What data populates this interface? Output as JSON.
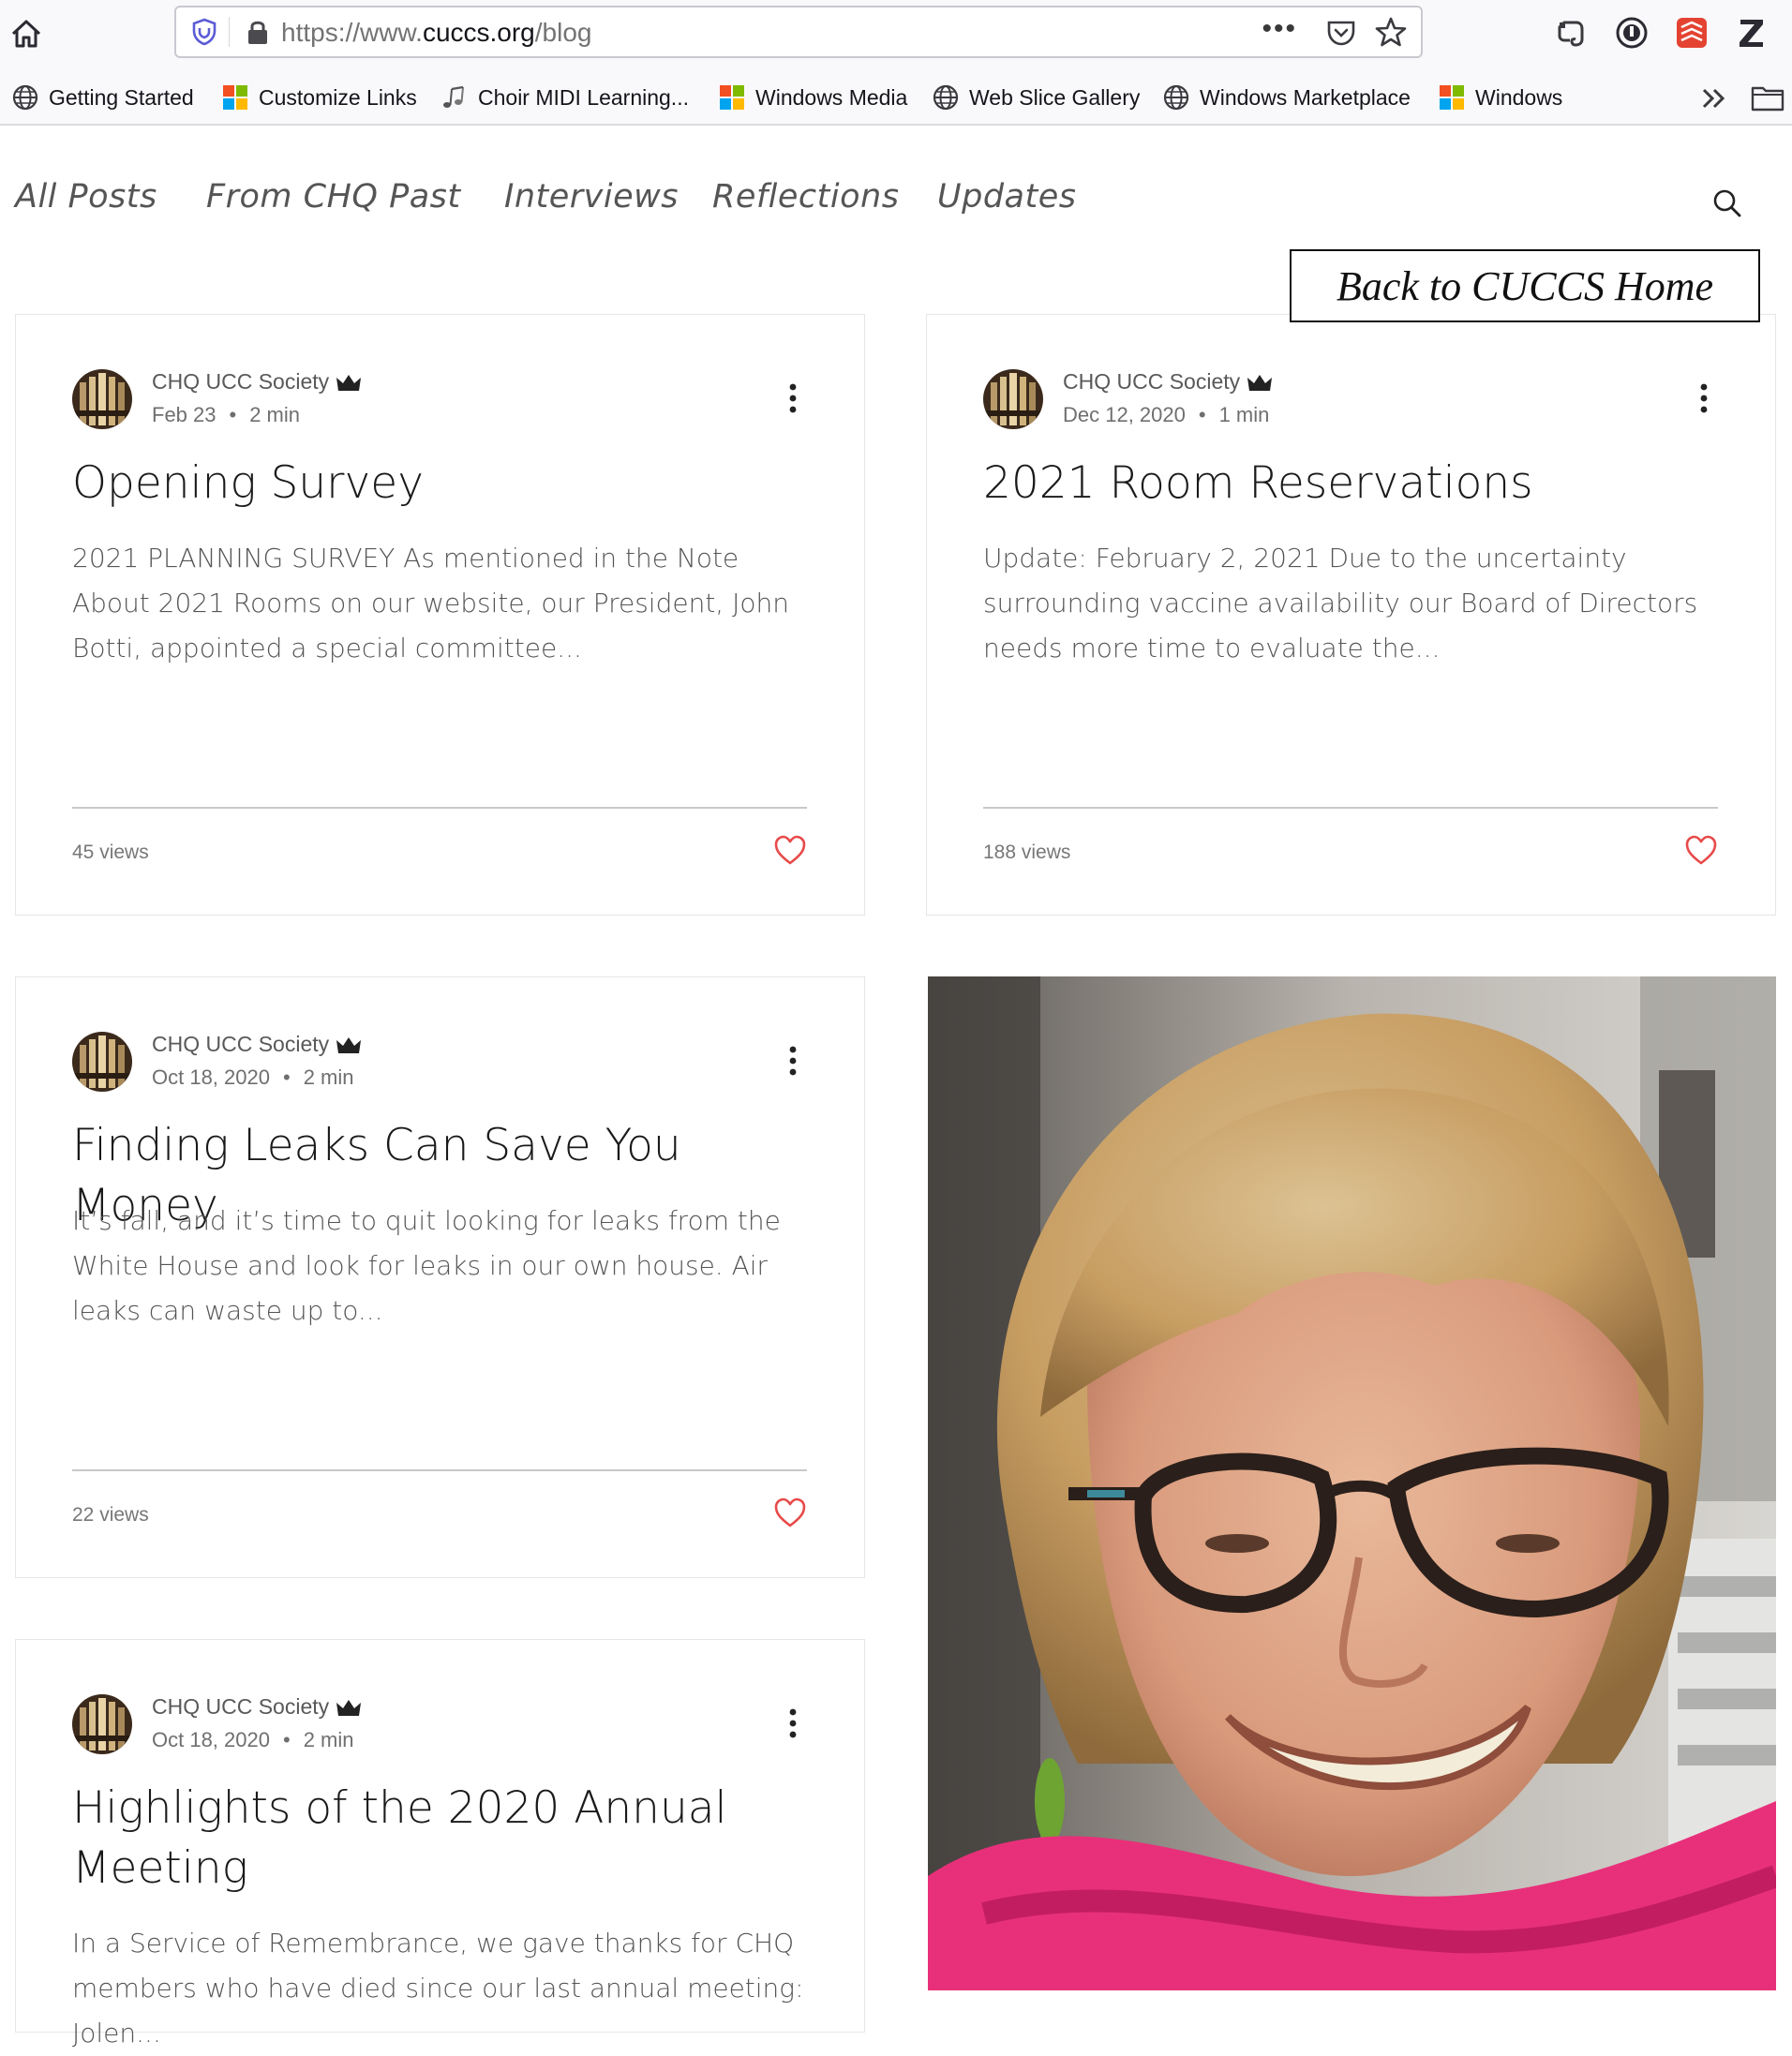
{
  "browser": {
    "url_prefix": "https://www.",
    "url_domain": "cuccs.org",
    "url_path": "/blog",
    "more_label": "•••",
    "bookmarks": [
      {
        "label": "Getting Started",
        "icon": "globe-icon"
      },
      {
        "label": "Customize Links",
        "icon": "windows-logo-icon"
      },
      {
        "label": "Choir MIDI Learning...",
        "icon": "music-notes-icon"
      },
      {
        "label": "Windows Media",
        "icon": "windows-logo-icon"
      },
      {
        "label": "Web Slice Gallery",
        "icon": "globe-icon"
      },
      {
        "label": "Windows Marketplace",
        "icon": "globe-icon"
      },
      {
        "label": "Windows",
        "icon": "windows-logo-icon"
      }
    ],
    "extensions": [
      "evernote-icon",
      "password-manager-icon",
      "todoist-icon",
      "zotero-icon"
    ]
  },
  "nav": {
    "items": [
      "All Posts",
      "From CHQ Past",
      "Interviews",
      "Reflections",
      "Updates"
    ],
    "back_home_label": "Back to CUCCS Home"
  },
  "posts": [
    {
      "author": "CHQ UCC Society",
      "date": "Feb 23",
      "read_time": "2 min",
      "title": "Opening Survey",
      "excerpt": "2021 PLANNING SURVEY As mentioned in the Note About 2021 Rooms on our website, our President, John Botti, appointed a special committee...",
      "views": "45 views"
    },
    {
      "author": "CHQ UCC Society",
      "date": "Dec 12, 2020",
      "read_time": "1 min",
      "title": "2021 Room Reservations",
      "excerpt": "Update: February 2, 2021 Due to the uncertainty surrounding vaccine availability our Board of Directors needs more time to evaluate the...",
      "views": "188 views"
    },
    {
      "author": "CHQ UCC Society",
      "date": "Oct 18, 2020",
      "read_time": "2 min",
      "title": "Finding Leaks Can Save You Money",
      "excerpt": "It’s fall, and it’s time to quit looking for leaks from the White House and look for leaks in our own house. Air leaks can waste up to...",
      "views": "22 views"
    },
    {
      "author": "CHQ UCC Society",
      "date": "Oct 18, 2020",
      "read_time": "2 min",
      "title": "Highlights of the 2020 Annual Meeting",
      "excerpt": "In a Service of Remembrance, we gave thanks for CHQ members who have died since our last annual meeting: Jolen..."
    }
  ],
  "colors": {
    "heart": "#e84a4a",
    "accent_pink": "#e8307a"
  }
}
